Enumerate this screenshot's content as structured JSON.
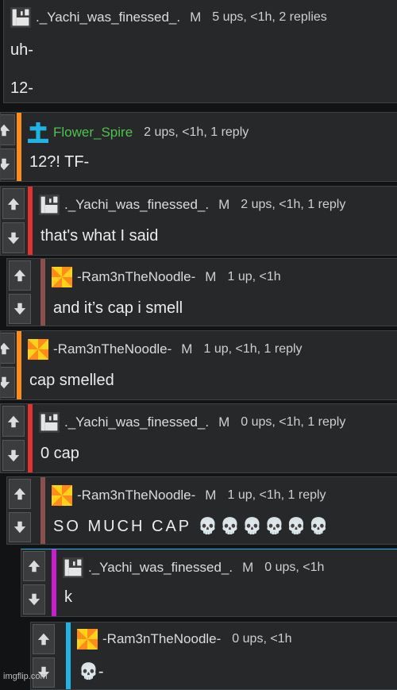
{
  "colors": {
    "bar_orange": "#ff8c1a",
    "bar_red": "#e13232",
    "bar_brown": "#8a4f4f",
    "bar_magenta": "#c81ed0",
    "bar_blue": "#20b4e6",
    "link_blue": "#3fb9ff",
    "username_green": "#4fc24d"
  },
  "icons": {
    "vote_up": "arrow-up-icon",
    "vote_down": "arrow-down-icon",
    "yachi_avatar": "pixel-castle-avatar",
    "flower_avatar": "blue-cross-avatar",
    "ram_avatar": "pinwheel-avatar"
  },
  "comments": [
    {
      "username": "._Yachi_was_finessed_.",
      "badge": "M",
      "meta": "5 ups, <1h, 2 replies",
      "body": "uh-\n\n12-",
      "bar": "none",
      "has_votes": false
    },
    {
      "username": "Flower_Spire",
      "badge": "",
      "meta": "2 ups, <1h, 1 reply",
      "body": "12?! TF-",
      "bar": "orange",
      "has_votes": true
    },
    {
      "username": "._Yachi_was_finessed_.",
      "badge": "M",
      "meta": "2 ups, <1h, 1 reply",
      "body": "that's what I said",
      "bar": "red",
      "has_votes": true
    },
    {
      "username": "-Ram3nTheNoodle-",
      "badge": "M",
      "meta": "1 up, <1h",
      "body": "and it’s cap i smell",
      "bar": "brown",
      "has_votes": true
    },
    {
      "username": "-Ram3nTheNoodle-",
      "badge": "M",
      "meta": "1 up, <1h, 1 reply",
      "body": "cap smelled",
      "bar": "orange",
      "has_votes": true
    },
    {
      "username": "._Yachi_was_finessed_.",
      "badge": "M",
      "meta": "0 ups, <1h, 1 reply",
      "body": "0 cap",
      "bar": "red",
      "has_votes": true
    },
    {
      "username": "-Ram3nTheNoodle-",
      "badge": "M",
      "meta": "1 up, <1h, 1 reply",
      "body": "SO MUCH CAP 💀💀💀💀💀💀",
      "bar": "brown",
      "has_votes": true
    },
    {
      "username": "._Yachi_was_finessed_.",
      "badge": "M",
      "meta": "0 ups, <1h",
      "body": "k",
      "bar": "magenta",
      "has_votes": true
    },
    {
      "username": "-Ram3nTheNoodle-",
      "badge": "",
      "meta": "0 ups, <1h",
      "body": "💀-",
      "bar": "blue",
      "has_votes": true
    }
  ],
  "watermark": "imgflip.com"
}
